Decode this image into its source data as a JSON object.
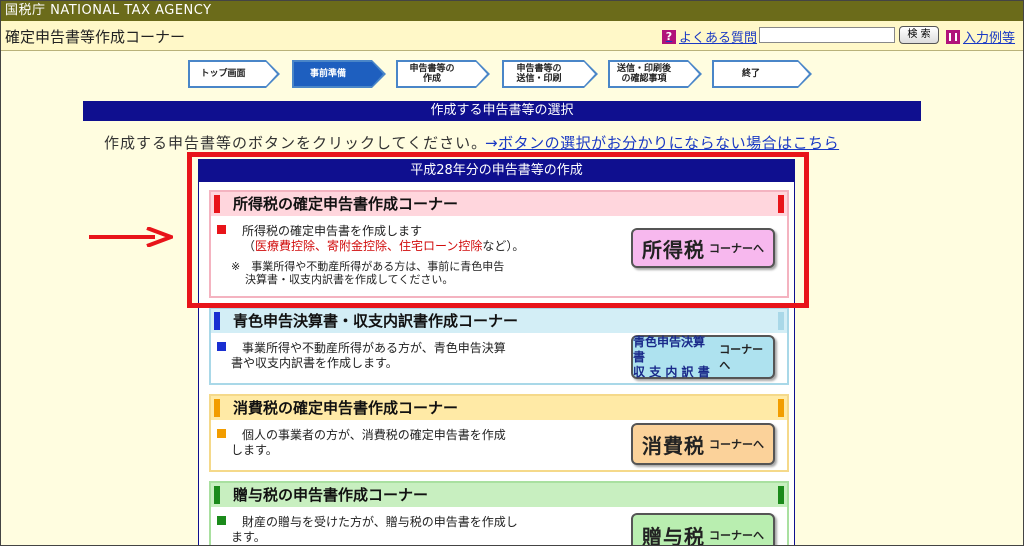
{
  "agency": {
    "name": "国税庁  NATIONAL TAX AGENCY"
  },
  "header": {
    "title": "確定申告書等作成コーナー",
    "faq_label": "よくある質問",
    "search_placeholder": "",
    "search_button": "検 索",
    "examples_label": "入力例等"
  },
  "steps": [
    {
      "label": "トップ画面",
      "active": false
    },
    {
      "label": "事前準備",
      "active": true
    },
    {
      "label": "申告書等の\n作成",
      "active": false
    },
    {
      "label": "申告書等の\n送信・印刷",
      "active": false
    },
    {
      "label": "送信・印刷後\nの確認事項",
      "active": false
    },
    {
      "label": "終了",
      "active": false
    }
  ],
  "section_header": "作成する申告書等の選択",
  "instruction": {
    "text": "作成する申告書等のボタンをクリックしてください。",
    "link_prefix": "→",
    "link_text": "ボタンの選択がお分かりにならない場合はこちら"
  },
  "year_panel": {
    "title": "平成28年分の申告書等の作成"
  },
  "corners": [
    {
      "title": "所得税の確定申告書作成コーナー",
      "line1": "所得税の確定申告書を作成します",
      "line2_prefix": "（",
      "line2_red": "医療費控除、寄附金控除、住宅ローン控除",
      "line2_suffix": "など）。",
      "note1": "※　事業所得や不動産所得がある方は、事前に青色申告",
      "note2": "決算書・収支内訳書を作成してください。",
      "button_main": "所得税",
      "button_sub": "コーナーへ",
      "accent": "#e8141a",
      "head_bg": "#ffd6dd",
      "border": "#f4b3c0",
      "button_bg": "#f7b8ee"
    },
    {
      "title": "青色申告決算書・収支内訳書作成コーナー",
      "line1": "事業所得や不動産所得がある方が、青色申告決算",
      "line2": "書や収支内訳書を作成します。",
      "button_main_1": "青色申告決算書",
      "button_main_2": "収 支 内 訳 書",
      "button_sub": "コーナーへ",
      "accent": "#1a2fd1",
      "head_bg": "#d3eef6",
      "border": "#a9d8e8",
      "button_bg": "#aee2ef"
    },
    {
      "title": "消費税の確定申告書作成コーナー",
      "line1": "個人の事業者の方が、消費税の確定申告書を作成",
      "line2": "します。",
      "button_main": "消費税",
      "button_sub": "コーナーへ",
      "accent": "#f29d00",
      "head_bg": "#ffeaa6",
      "border": "#f5d98a",
      "button_bg": "#fbd29a"
    },
    {
      "title": "贈与税の申告書作成コーナー",
      "line1": "財産の贈与を受けた方が、贈与税の申告書を作成し",
      "line2": "ます。",
      "button_main": "贈与税",
      "button_sub": "コーナーへ",
      "accent": "#1b8a1b",
      "head_bg": "#c8efc0",
      "border": "#a9e0a0",
      "button_bg": "#b9eeb0"
    }
  ]
}
